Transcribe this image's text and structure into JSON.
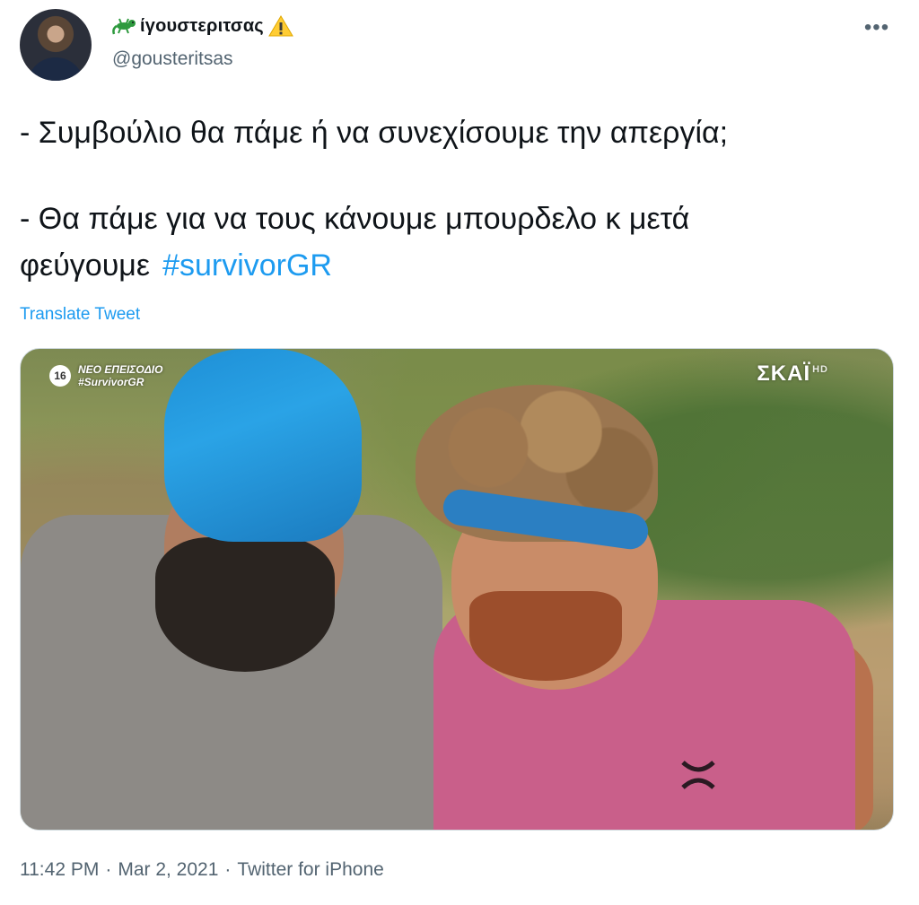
{
  "author": {
    "display_name": "ίγουστεριτσας",
    "handle": "@gousteritsas",
    "name_prefix_icon": "lizard-icon",
    "name_suffix_icon": "warning-icon"
  },
  "tweet": {
    "line1": "- Συμβούλιο θα πάμε ή να συνεχίσουμε την απεργία;",
    "line2": "- Θα πάμε για να τους κάνουμε μπουρδελο κ μετά",
    "line3": "φεύγουμε",
    "hashtag": "#survivorGR",
    "translate_label": "Translate Tweet"
  },
  "media": {
    "age_rating": "16",
    "episode_label": "ΝΕΟ ΕΠΕΙΣΟΔΙΟ",
    "episode_hashtag": "#SurvivorGR",
    "channel_name": "ΣΚΑΪ",
    "channel_suffix": "HD"
  },
  "footer": {
    "time": "11:42 PM",
    "date": "Mar 2, 2021",
    "source": "Twitter for iPhone",
    "separator": "·"
  },
  "colors": {
    "link": "#1d9bf0",
    "secondary_text": "#536471",
    "primary_text": "#0f1419"
  }
}
